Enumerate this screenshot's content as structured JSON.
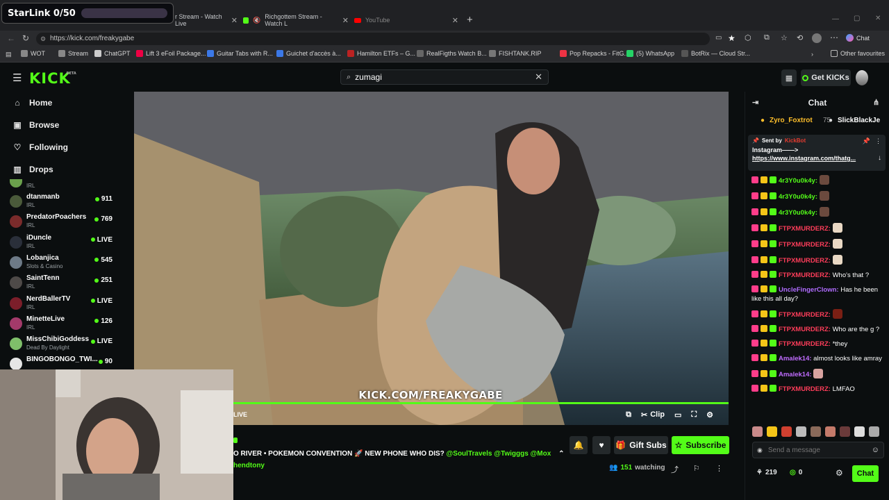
{
  "overlay": {
    "title": "StarLink 0/50",
    "progress": 0
  },
  "browser": {
    "tabs": [
      {
        "title": "r Stream - Watch Live",
        "icon": "kick-icon"
      },
      {
        "title": "Richgottem Stream - Watch L",
        "icon": "kick-icon"
      },
      {
        "title": "YouTube",
        "icon": "youtube-icon"
      }
    ],
    "url": "https://kick.com/freakygabe",
    "profile_label": "Chat",
    "bookmarks": [
      "WOT",
      "Stream",
      "ChatGPT",
      "Lift 3 eFoil Package...",
      "Guitar Tabs with R...",
      "Guichet d'accès à...",
      "Hamilton ETFs – G...",
      "RealFigths Watch B...",
      "FISHTANK.RIP",
      "Pop Repacks - FitG...",
      "(5) WhatsApp",
      "BotRix — Cloud Str..."
    ],
    "other_favourites": "Other favourites"
  },
  "header": {
    "logo": "KICK",
    "logo_badge": "BETA",
    "search_value": "zumagi",
    "get_kicks": "Get KICKs"
  },
  "sidebar": {
    "nav": [
      "Home",
      "Browse",
      "Following",
      "Drops"
    ],
    "top_category": "IRL",
    "channels": [
      {
        "name": "dtanmanb",
        "category": "IRL",
        "viewers": "911"
      },
      {
        "name": "PredatorPoachers",
        "category": "IRL",
        "viewers": "769"
      },
      {
        "name": "iDuncle",
        "category": "IRL",
        "viewers": "LIVE"
      },
      {
        "name": "Lobanjica",
        "category": "Slots & Casino",
        "viewers": "545"
      },
      {
        "name": "SaintTenn",
        "category": "IRL",
        "viewers": "251"
      },
      {
        "name": "NerdBallerTV",
        "category": "IRL",
        "viewers": "LIVE"
      },
      {
        "name": "MinetteLive",
        "category": "IRL",
        "viewers": "126"
      },
      {
        "name": "MissChibiGoddess",
        "category": "Dead By Daylight",
        "viewers": "LIVE"
      },
      {
        "name": "BINGOBONGO_TWI...",
        "category": "",
        "viewers": "90"
      }
    ]
  },
  "player": {
    "watermark": "KICK.COM/FREAKYGABE",
    "live_label": "LIVE",
    "clip_label": "Clip"
  },
  "stream": {
    "title_plain": "O RIVER • POKEMON CONVENTION 🚀 NEW PHONE WHO DIS? ",
    "title_mentions": "@SoulTravels @Twigggs @Mox",
    "subline": "hendtony",
    "gift_subs": "Gift Subs",
    "subscribe": "Subscribe",
    "watching_count": "151",
    "watching_label": "watching"
  },
  "chat": {
    "title": "Chat",
    "gifters": [
      {
        "name": "Zyro_Foxtrot",
        "count": "75"
      },
      {
        "name": "SlickBlackJe",
        "count": ""
      }
    ],
    "pinned": {
      "sent_by_label": "Sent by",
      "sender": "KickBot",
      "line1": "Instagram——>",
      "line2": "https://www.instagram.com/thatg..."
    },
    "messages": [
      {
        "user": "4r3Y0u0k4y:",
        "color": "#53fc18",
        "text": "",
        "emote": "#6b4a3e"
      },
      {
        "user": "4r3Y0u0k4y:",
        "color": "#53fc18",
        "text": "",
        "emote": "#6b4a3e"
      },
      {
        "user": "4r3Y0u0k4y:",
        "color": "#53fc18",
        "text": "",
        "emote": "#6b4a3e"
      },
      {
        "user": "FTPXMURDERZ:",
        "color": "#ff3d5a",
        "text": "",
        "emote": "#e9d8c4"
      },
      {
        "user": "FTPXMURDERZ:",
        "color": "#ff3d5a",
        "text": "",
        "emote": "#e9d8c4"
      },
      {
        "user": "FTPXMURDERZ:",
        "color": "#ff3d5a",
        "text": "",
        "emote": "#e9d8c4"
      },
      {
        "user": "FTPXMURDERZ:",
        "color": "#ff3d5a",
        "text": "Who's that ?",
        "emote": ""
      },
      {
        "user": "UncleFingerClown:",
        "color": "#b06cff",
        "text": "Has he been like this all day?",
        "emote": ""
      },
      {
        "user": "FTPXMURDERZ:",
        "color": "#ff3d5a",
        "text": "",
        "emote": "#7a1f14"
      },
      {
        "user": "FTPXMURDERZ:",
        "color": "#ff3d5a",
        "text": "Who are the g ?",
        "emote": ""
      },
      {
        "user": "FTPXMURDERZ:",
        "color": "#ff3d5a",
        "text": "*they",
        "emote": ""
      },
      {
        "user": "Amalek14:",
        "color": "#c06cff",
        "text": "almost looks like amray",
        "emote": ""
      },
      {
        "user": "Amalek14:",
        "color": "#c06cff",
        "text": "",
        "emote": "#d8a3a0"
      },
      {
        "user": "FTPXMURDERZ:",
        "color": "#ff3d5a",
        "text": "LMFAO",
        "emote": ""
      }
    ],
    "send_placeholder": "Send a message",
    "points": "219",
    "kicks": "0",
    "chat_button": "Chat"
  }
}
